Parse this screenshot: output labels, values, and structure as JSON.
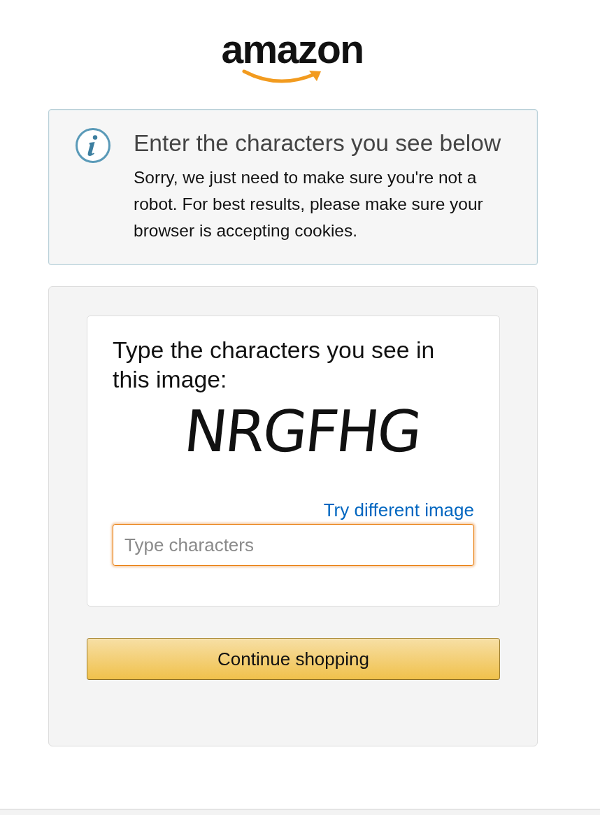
{
  "logo": {
    "text": "amazon"
  },
  "alert": {
    "title": "Enter the characters you see below",
    "message": "Sorry, we just need to make sure you're not a robot. For best results, please make sure your browser is accepting cookies."
  },
  "captcha_form": {
    "heading": "Type the characters you see in this image:",
    "captcha_text": "NRGFHG",
    "refresh_link": "Try different image",
    "input": {
      "placeholder": "Type characters",
      "focused": true
    },
    "submit_button": "Continue shopping"
  }
}
